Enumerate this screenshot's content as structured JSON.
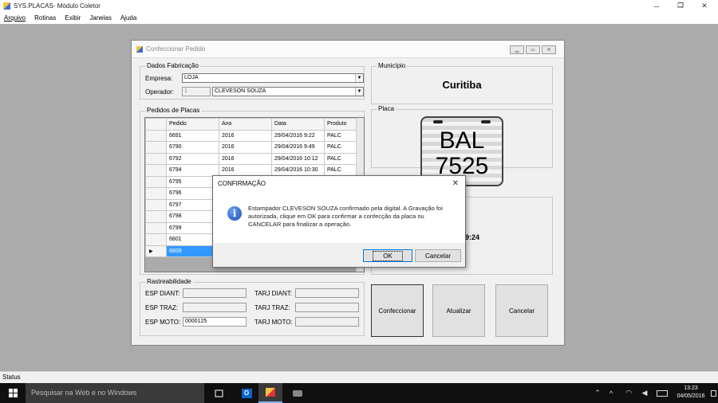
{
  "window": {
    "title": "SYS.PLACAS- Módulo Coletor"
  },
  "menu": [
    "Arquivo",
    "Rotinas",
    "Exibir",
    "Janelas",
    "Ajuda"
  ],
  "form": {
    "title": "Confeccionar Pedido",
    "dados_fabricacao": {
      "legend": "Dados Fabricação",
      "empresa_label": "Empresa:",
      "empresa_value": "LOJA",
      "operador_label": "Operador:",
      "operador_id": "1",
      "operador_name": "CLEVESON SOUZA"
    },
    "pedidos": {
      "legend": "Pedidos de Placas",
      "columns": [
        "Pedido",
        "Ano",
        "Data",
        "Produto"
      ],
      "rows": [
        [
          "6691",
          "2016",
          "29/04/2016 9:22",
          "PALC"
        ],
        [
          "6790",
          "2016",
          "29/04/2016 9:49",
          "PALC"
        ],
        [
          "6792",
          "2016",
          "29/04/2016 10:12",
          "PALC"
        ],
        [
          "6794",
          "2016",
          "29/04/2016 10:30",
          "PALC"
        ],
        [
          "6795",
          "",
          "",
          ""
        ],
        [
          "6796",
          "",
          "",
          ""
        ],
        [
          "6797",
          "",
          "",
          ""
        ],
        [
          "6798",
          "",
          "",
          ""
        ],
        [
          "6799",
          "",
          "",
          ""
        ],
        [
          "6801",
          "",
          "",
          ""
        ],
        [
          "6809",
          "",
          "",
          ""
        ]
      ],
      "selected_index": 10
    },
    "municipio": {
      "legend": "Município",
      "value": "Curitiba"
    },
    "placa": {
      "legend": "Placa",
      "letters": "BAL",
      "numbers": "7525"
    },
    "info_time": "9:24",
    "rastreabilidade": {
      "legend": "Rastreabilidade",
      "esp_diant_label": "ESP DIANT:",
      "esp_traz_label": "ESP TRAZ:",
      "esp_moto_label": "ESP MOTO:",
      "esp_moto_value": "0000125",
      "tarj_diant_label": "TARJ DIANT:",
      "tarj_traz_label": "TARJ TRAZ:",
      "tarj_moto_label": "TARJ MOTO:"
    },
    "buttons": {
      "confeccionar": "Confeccionar",
      "atualizar": "Atualizar",
      "cancelar": "Cancelar"
    }
  },
  "dialog": {
    "title": "CONFIRMAÇÃO",
    "message": "Estampador CLEVESON SOUZA confirmado pela digital. A Gravação foi autorizada, clique em OK para confirmar a confecção da placa ou CANCELAR para finalizar a operação.",
    "ok": "OK",
    "cancel": "Cancelar"
  },
  "statusbar": {
    "text": "Status"
  },
  "taskbar": {
    "search_placeholder": "Pesquisar na Web e no Windows",
    "time": "13:23",
    "date": "04/05/2016"
  }
}
